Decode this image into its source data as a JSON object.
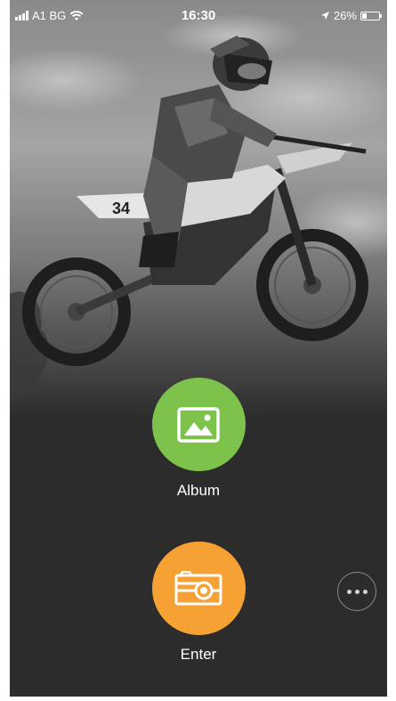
{
  "status_bar": {
    "carrier": "A1 BG",
    "time": "16:30",
    "battery": "26%",
    "battery_level": 0.26,
    "icons": [
      "signal-icon",
      "wifi-icon",
      "location-arrow-icon",
      "battery-icon"
    ]
  },
  "hero": {
    "image": "motocross-rider-photo"
  },
  "actions": {
    "album": {
      "label": "Album",
      "icon": "image-icon",
      "color": "#7cc24b"
    },
    "enter": {
      "label": "Enter",
      "icon": "camera-icon",
      "color": "#f6a133"
    }
  },
  "more": {
    "icon": "more-dots-icon"
  }
}
